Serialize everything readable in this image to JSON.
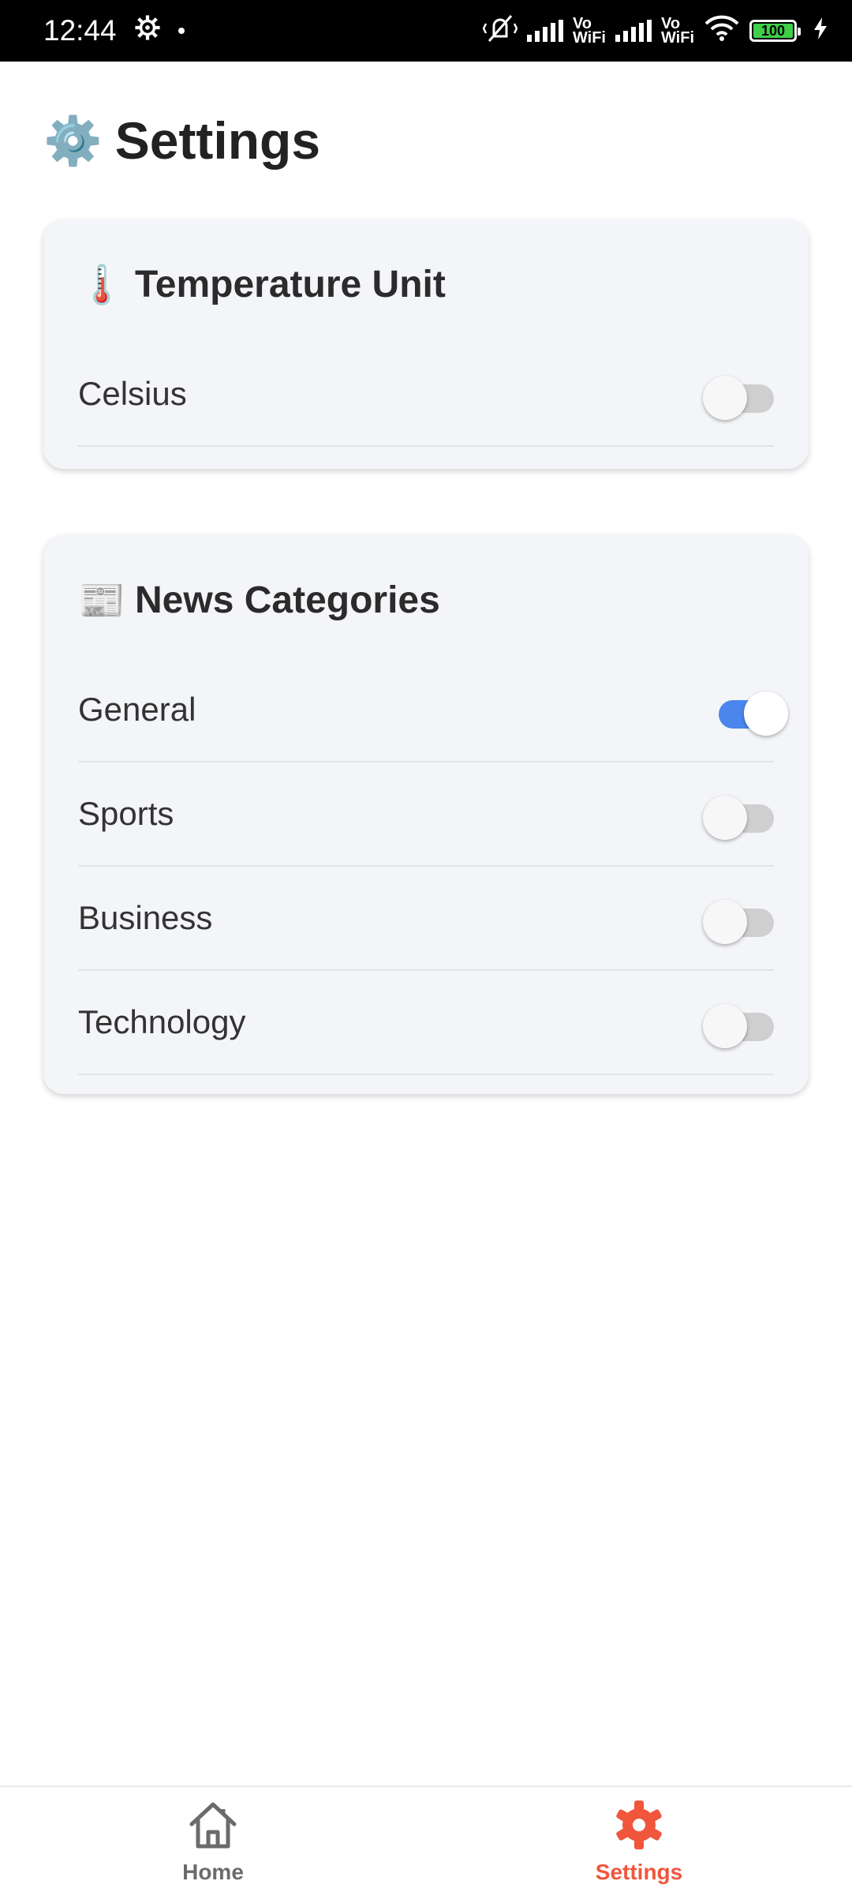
{
  "status_bar": {
    "time": "12:44",
    "vowifi_top": "Vo",
    "vowifi_bottom": "WiFi",
    "battery": "100"
  },
  "page": {
    "title": "Settings",
    "title_icon": "gear-icon"
  },
  "temperature_card": {
    "icon": "thermometer-icon",
    "title": "Temperature Unit",
    "rows": [
      {
        "label": "Celsius",
        "enabled": false
      }
    ]
  },
  "news_card": {
    "icon": "newspaper-icon",
    "title": "News Categories",
    "rows": [
      {
        "label": "General",
        "enabled": true
      },
      {
        "label": "Sports",
        "enabled": false
      },
      {
        "label": "Business",
        "enabled": false
      },
      {
        "label": "Technology",
        "enabled": false
      }
    ]
  },
  "bottom_nav": {
    "items": [
      {
        "label": "Home",
        "icon": "home-icon",
        "active": false
      },
      {
        "label": "Settings",
        "icon": "gear-icon",
        "active": true
      }
    ]
  },
  "colors": {
    "accent": "#f0563c",
    "toggle_on": "#4a86ec",
    "card_bg": "#f4f5f8"
  }
}
